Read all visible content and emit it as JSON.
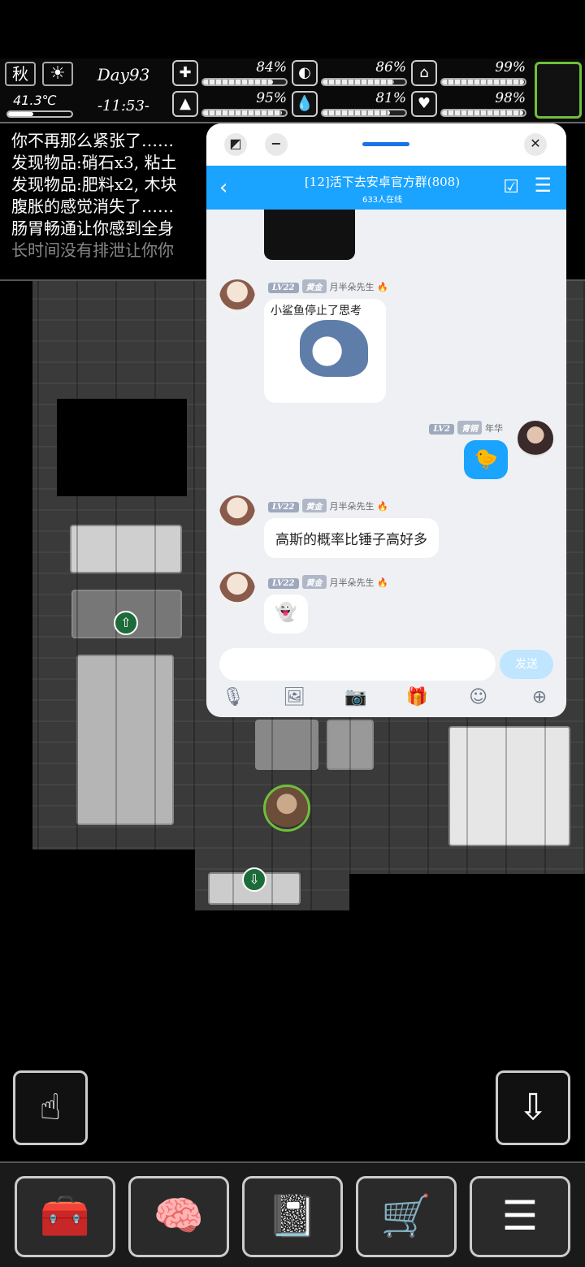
{
  "hud": {
    "season": "秋",
    "temperature": "41.3℃",
    "day": "Day93",
    "time": "-11:53-",
    "stats": [
      {
        "icon": "medkit-icon",
        "glyph": "✚",
        "value": "84%",
        "level": 0.84
      },
      {
        "icon": "stomach-icon",
        "glyph": "◐",
        "value": "86%",
        "level": 0.86
      },
      {
        "icon": "bladder-icon",
        "glyph": "⌂",
        "value": "99%",
        "level": 0.99
      },
      {
        "icon": "boot-icon",
        "glyph": "▲",
        "value": "95%",
        "level": 0.95
      },
      {
        "icon": "water-drop-icon",
        "glyph": "💧",
        "value": "81%",
        "level": 0.81
      },
      {
        "icon": "heart-icon",
        "glyph": "♥",
        "value": "98%",
        "level": 0.98
      }
    ]
  },
  "log": [
    "你不再那么紧张了……",
    "发现物品:硝石x3, 粘土",
    "发现物品:肥料x2, 木块",
    "腹胀的感觉消失了……",
    "肠胃畅通让你感到全身",
    "长时间没有排泄让你你"
  ],
  "chat": {
    "title": "[12]活下去安卓官方群(808)",
    "online": "633人在线",
    "messages": [
      {
        "side": "left",
        "level": "LV22",
        "rank": "黄金",
        "name": "月半朵先生",
        "type": "sticker",
        "text": "小鲨鱼停止了思考"
      },
      {
        "side": "right",
        "level": "LV2",
        "rank": "青铜",
        "name": "年华",
        "type": "emoji"
      },
      {
        "side": "left",
        "level": "LV22",
        "rank": "黄金",
        "name": "月半朵先生",
        "type": "text",
        "text": "高斯的概率比锤子高好多"
      },
      {
        "side": "left",
        "level": "LV22",
        "rank": "黄金",
        "name": "月半朵先生",
        "type": "emoji"
      }
    ],
    "input_placeholder": "",
    "send_label": "发送"
  }
}
